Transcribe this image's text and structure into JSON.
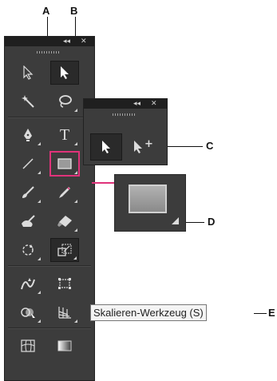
{
  "callouts": {
    "a": "A",
    "b": "B",
    "c": "C",
    "d": "D",
    "e": "E"
  },
  "tooltip": {
    "text": "Skalieren-Werkzeug (S)"
  },
  "main_panel": {
    "collapse_glyph": "◂◂",
    "close_glyph": "✕",
    "tools": [
      {
        "name": "selection-tool",
        "icon": "arrow-outline-icon"
      },
      {
        "name": "direct-selection-tool",
        "icon": "arrow-filled-icon",
        "selected": true
      },
      {
        "name": "magic-wand-tool",
        "icon": "magic-wand-icon"
      },
      {
        "name": "lasso-tool",
        "icon": "lasso-icon"
      },
      {
        "name": "pen-tool",
        "icon": "pen-icon"
      },
      {
        "name": "type-tool",
        "icon": "type-icon",
        "glyph": "T"
      },
      {
        "name": "line-segment-tool",
        "icon": "line-icon"
      },
      {
        "name": "rectangle-tool",
        "icon": "rectangle-icon",
        "highlighted": true
      },
      {
        "name": "paintbrush-tool",
        "icon": "brush-icon"
      },
      {
        "name": "pencil-tool",
        "icon": "pencil-icon"
      },
      {
        "name": "blob-brush-tool",
        "icon": "blob-brush-icon"
      },
      {
        "name": "eraser-tool",
        "icon": "eraser-icon"
      },
      {
        "name": "rotate-tool",
        "icon": "rotate-icon"
      },
      {
        "name": "scale-tool",
        "icon": "scale-icon",
        "selected": true
      },
      {
        "name": "warp-tool",
        "icon": "warp-icon"
      },
      {
        "name": "free-transform-tool",
        "icon": "free-transform-icon"
      },
      {
        "name": "shape-builder-tool",
        "icon": "shape-builder-icon"
      },
      {
        "name": "perspective-grid-tool",
        "icon": "perspective-grid-icon"
      },
      {
        "name": "mesh-tool",
        "icon": "mesh-icon"
      },
      {
        "name": "gradient-tool",
        "icon": "gradient-icon"
      }
    ]
  },
  "flyout_panel": {
    "collapse_glyph": "◂◂",
    "close_glyph": "✕",
    "tools": [
      {
        "name": "direct-selection-tool",
        "icon": "arrow-filled-icon",
        "selected": true
      },
      {
        "name": "group-selection-tool",
        "icon": "arrow-plus-icon",
        "glyph": "+"
      }
    ]
  },
  "colors": {
    "highlight": "#e0337a",
    "panel": "#3c3c3c",
    "titlebar": "#1f1f1f"
  }
}
